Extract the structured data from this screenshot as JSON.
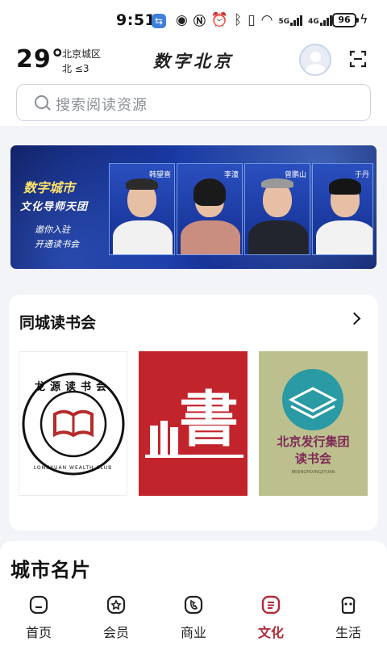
{
  "status_bar": {
    "time": "9:51",
    "network_1": "5G",
    "network_2": "4G",
    "battery": "96"
  },
  "header": {
    "temperature": "29°",
    "location": "北京城区",
    "wind": "北 ≤3",
    "app_title": "数字北京"
  },
  "search": {
    "placeholder": "搜索阅读资源"
  },
  "banner": {
    "title_line1": "数字城市",
    "title_line2": "文化导师天团",
    "invite_line1": "邀你入驻",
    "invite_line2": "开通读书会",
    "mentors": [
      {
        "name": "韩望喜"
      },
      {
        "name": "李潼"
      },
      {
        "name": "曾鹏山"
      },
      {
        "name": "于丹"
      }
    ]
  },
  "reading_club": {
    "title": "同城读书会",
    "items": [
      {
        "name": "龙源读书会",
        "subtitle": "LONGYUAN WEALTH CLUB"
      },
      {
        "name": "書"
      },
      {
        "name": "北京发行集团读书会",
        "subtitle": "BEIJINGFAXINGJITUAN"
      }
    ]
  },
  "city_card": {
    "title": "城市名片"
  },
  "tabbar": {
    "items": [
      {
        "label": "首页",
        "icon": "home-icon"
      },
      {
        "label": "会员",
        "icon": "member-icon"
      },
      {
        "label": "商业",
        "icon": "business-icon"
      },
      {
        "label": "文化",
        "icon": "culture-icon"
      },
      {
        "label": "生活",
        "icon": "life-icon"
      }
    ],
    "active_color": "#b22a38"
  }
}
